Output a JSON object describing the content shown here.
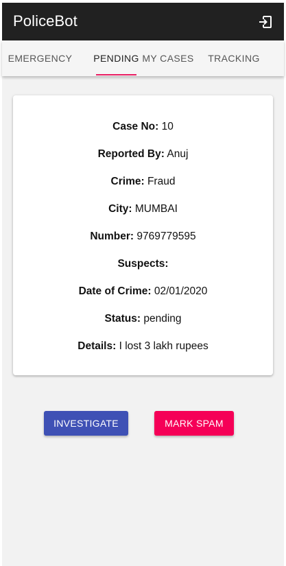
{
  "app": {
    "title": "PoliceBot"
  },
  "header": {
    "logout_icon": "logout-icon"
  },
  "tabs": [
    {
      "label": "EMERGENCY",
      "active": false
    },
    {
      "label": "PENDING",
      "active": true
    },
    {
      "label": "MY CASES",
      "active": false
    },
    {
      "label": "TRACKING",
      "active": false
    }
  ],
  "case": {
    "fields": [
      {
        "label": "Case No:",
        "value": "10"
      },
      {
        "label": "Reported By:",
        "value": "Anuj"
      },
      {
        "label": "Crime:",
        "value": "Fraud"
      },
      {
        "label": "City:",
        "value": "MUMBAI"
      },
      {
        "label": "Number:",
        "value": "9769779595"
      },
      {
        "label": "Suspects:",
        "value": ""
      },
      {
        "label": "Date of Crime:",
        "value": "02/01/2020"
      },
      {
        "label": "Status:",
        "value": "pending"
      },
      {
        "label": "Details:",
        "value": "I lost 3 lakh rupees"
      }
    ]
  },
  "actions": {
    "investigate_label": "INVESTIGATE",
    "spam_label": "MARK SPAM"
  },
  "colors": {
    "appbar": "#212121",
    "tab_indicator": "#e91e63",
    "investigate": "#3f51b5",
    "spam": "#f50057",
    "background": "#f2f2f2"
  }
}
